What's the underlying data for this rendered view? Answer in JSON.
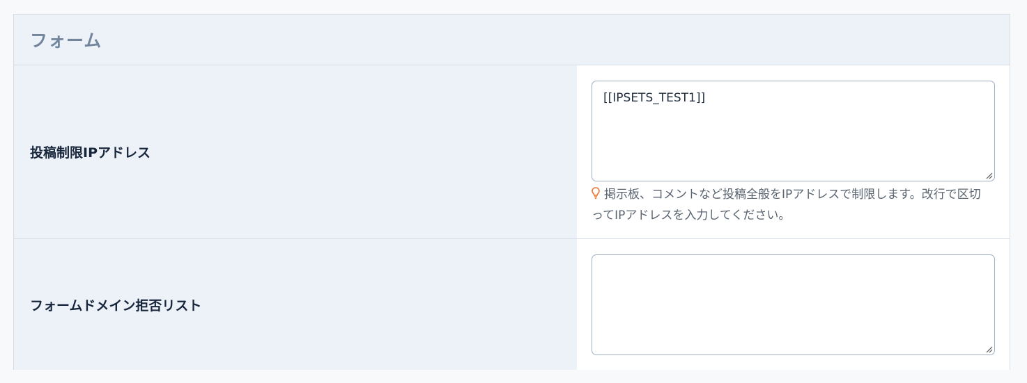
{
  "panel": {
    "title": "フォーム"
  },
  "rows": [
    {
      "label": "投稿制限IPアドレス",
      "field": {
        "value": "[[IPSETS_TEST1]]",
        "hint_icon": "lightbulb-icon",
        "hint": "掲示板、コメントなど投稿全般をIPアドレスで制限します。改行で区切ってIPアドレスを入力してください。"
      }
    },
    {
      "label": "フォームドメイン拒否リスト",
      "field": {
        "value": ""
      }
    }
  ],
  "colors": {
    "hint_icon": "#e8742b",
    "label_bg": "#edf1f8",
    "border": "#d6dde6"
  }
}
